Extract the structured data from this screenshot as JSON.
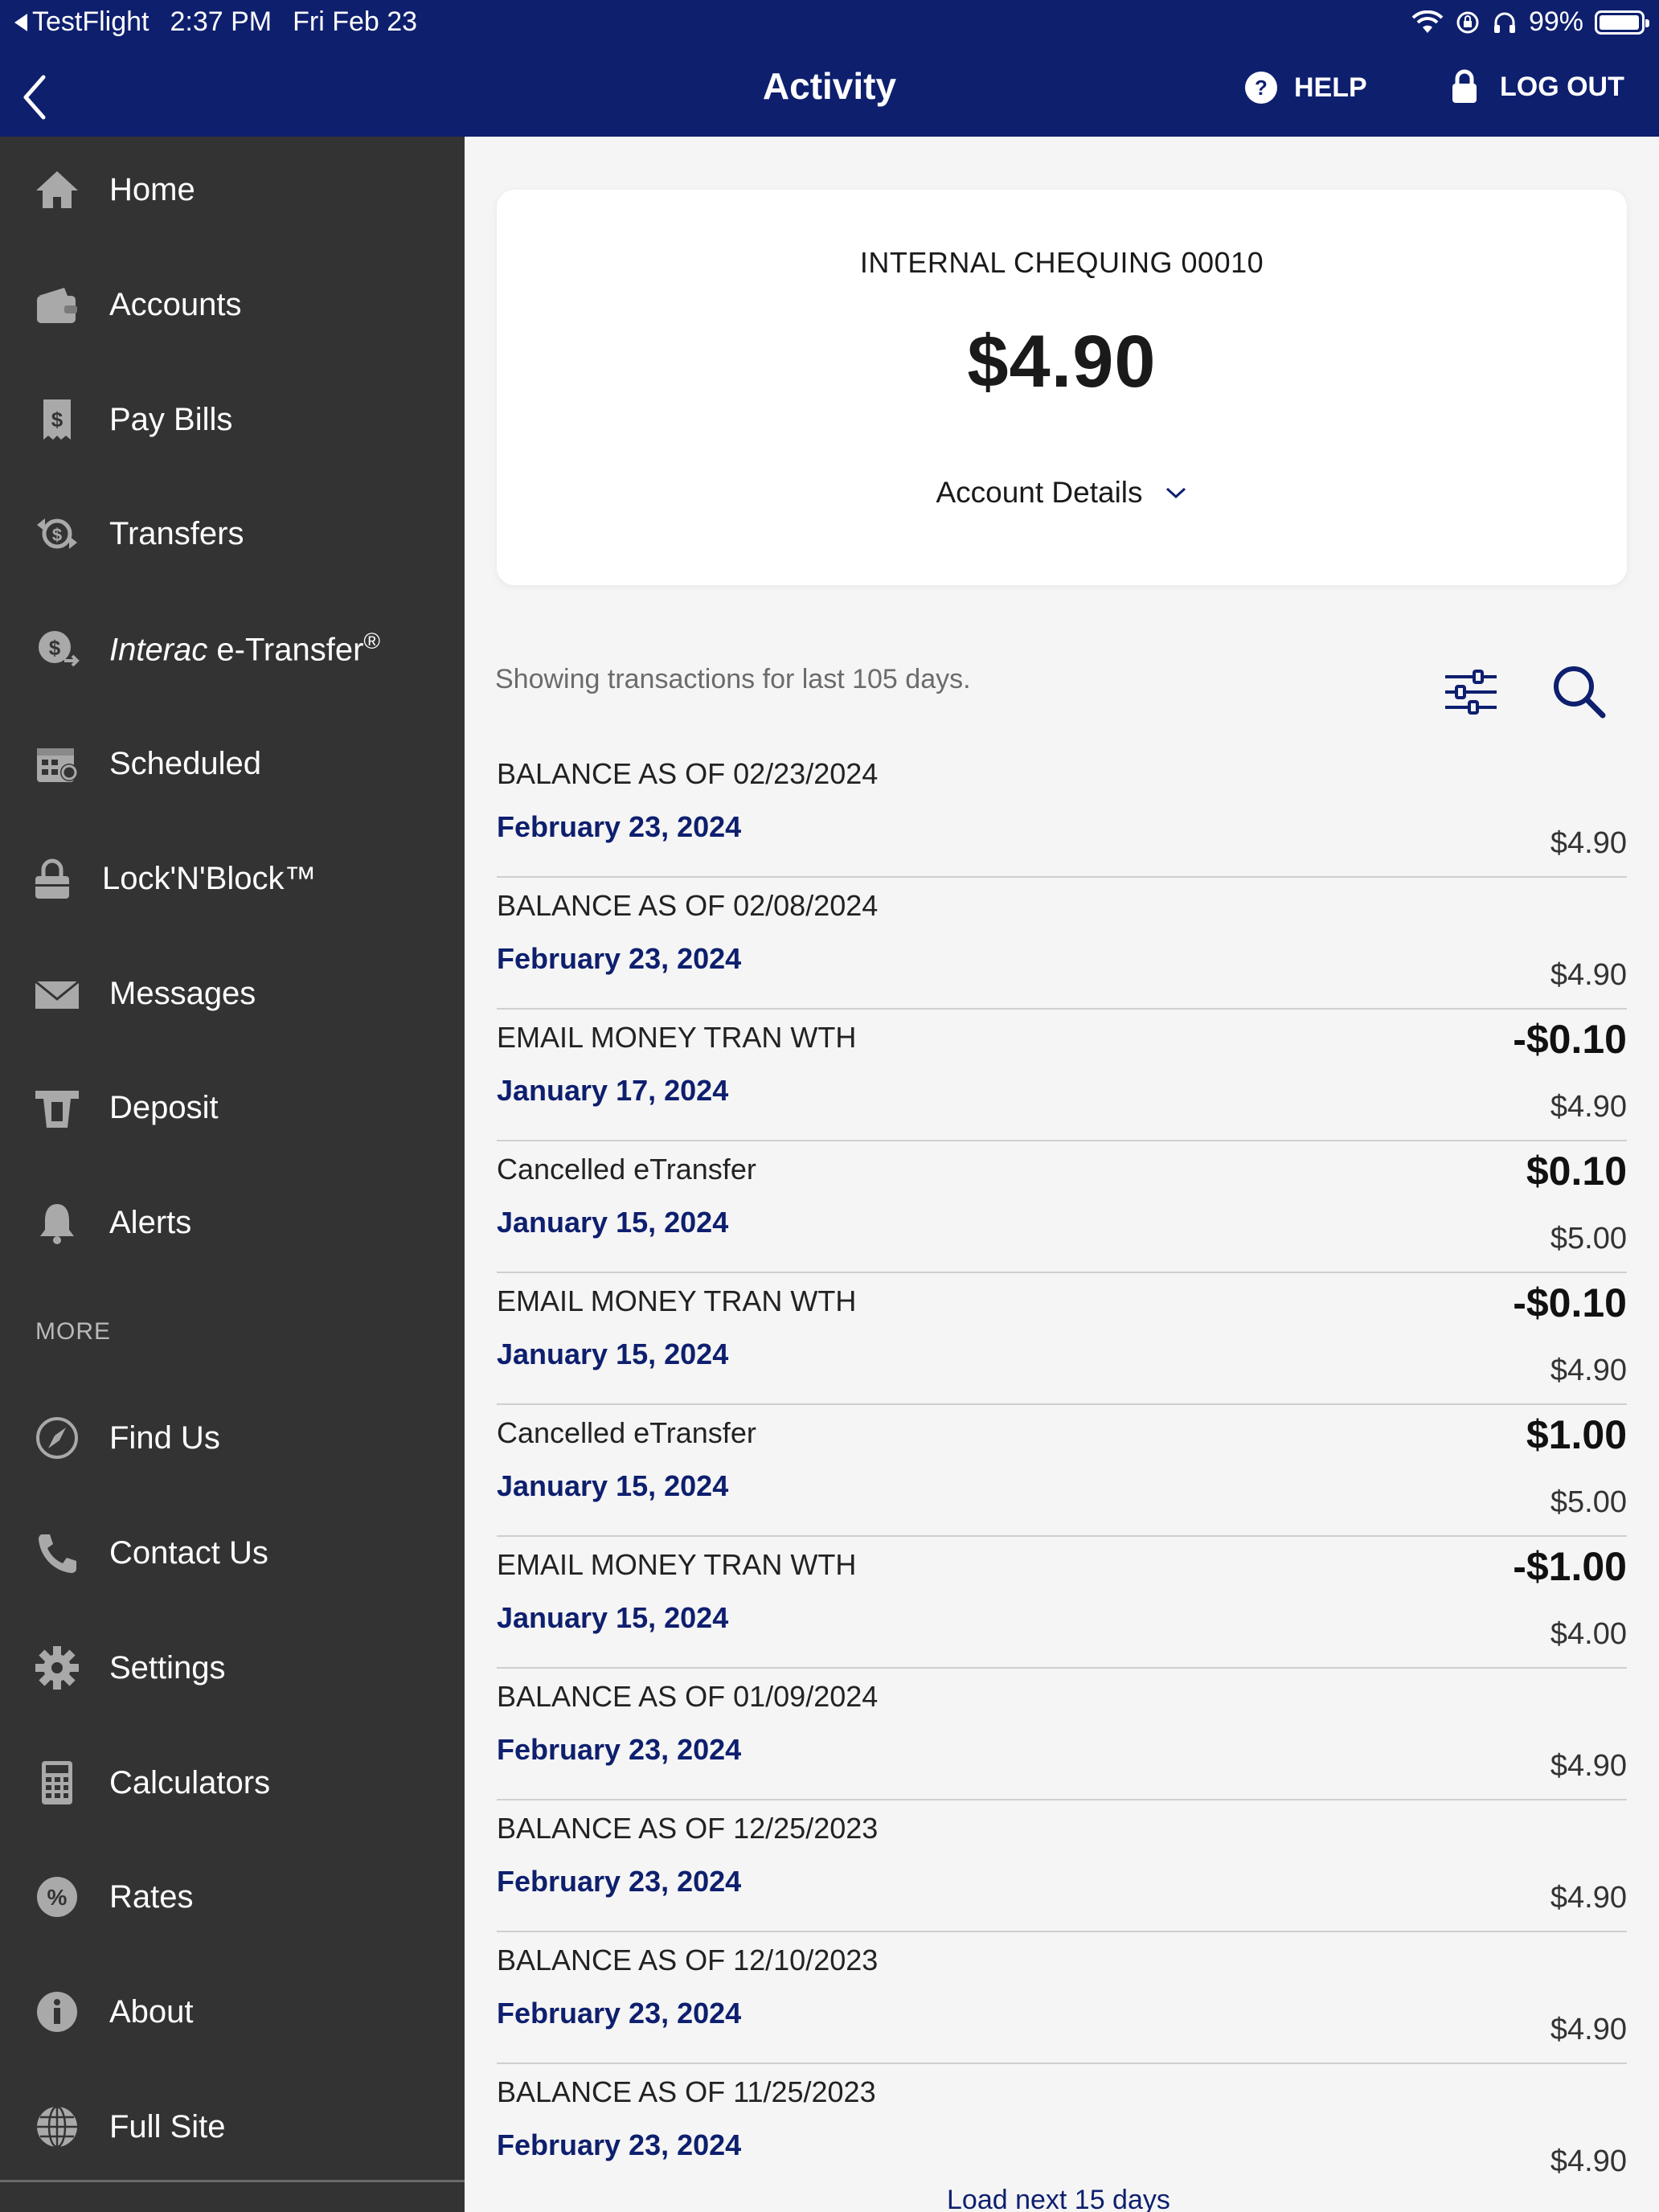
{
  "status_bar": {
    "back_app": "TestFlight",
    "time": "2:37 PM",
    "date": "Fri Feb 23",
    "battery": "99%"
  },
  "header": {
    "title": "Activity",
    "help_label": "HELP",
    "logout_label": "LOG OUT"
  },
  "sidebar": {
    "items": [
      {
        "label": "Home",
        "icon": "home-icon"
      },
      {
        "label": "Accounts",
        "icon": "wallet-icon"
      },
      {
        "label": "Pay Bills",
        "icon": "bill-icon"
      },
      {
        "label": "Transfers",
        "icon": "transfer-icon"
      },
      {
        "label_em": "Interac",
        "label_rest": " e-Transfer",
        "label_sup": "®",
        "icon": "etransfer-icon"
      },
      {
        "label": "Scheduled",
        "icon": "calendar-icon"
      },
      {
        "label": "Lock'N'Block™",
        "icon": "lock-icon"
      },
      {
        "label": "Messages",
        "icon": "envelope-icon"
      },
      {
        "label": "Deposit",
        "icon": "deposit-icon"
      },
      {
        "label": "Alerts",
        "icon": "bell-icon"
      }
    ],
    "more_header": "MORE",
    "more_items": [
      {
        "label": "Find Us",
        "icon": "compass-icon"
      },
      {
        "label": "Contact Us",
        "icon": "phone-icon"
      },
      {
        "label": "Settings",
        "icon": "gear-icon"
      },
      {
        "label": "Calculators",
        "icon": "calculator-icon"
      },
      {
        "label": "Rates",
        "icon": "percent-icon"
      },
      {
        "label": "About",
        "icon": "info-icon"
      },
      {
        "label": "Full Site",
        "icon": "globe-icon"
      }
    ]
  },
  "account": {
    "name": "INTERNAL CHEQUING 00010",
    "balance": "$4.90",
    "details_label": "Account Details"
  },
  "transactions_note": "Showing transactions for last 105 days.",
  "transactions": [
    {
      "desc": "BALANCE AS OF 02/23/2024",
      "date": "February 23, 2024",
      "amount": "",
      "balance": "$4.90"
    },
    {
      "desc": "BALANCE AS OF 02/08/2024",
      "date": "February 23, 2024",
      "amount": "",
      "balance": "$4.90"
    },
    {
      "desc": "EMAIL MONEY TRAN WTH",
      "date": "January 17, 2024",
      "amount": "-$0.10",
      "balance": "$4.90"
    },
    {
      "desc": "Cancelled eTransfer",
      "date": "January 15, 2024",
      "amount": "$0.10",
      "balance": "$5.00"
    },
    {
      "desc": "EMAIL MONEY TRAN WTH",
      "date": "January 15, 2024",
      "amount": "-$0.10",
      "balance": "$4.90"
    },
    {
      "desc": "Cancelled eTransfer",
      "date": "January 15, 2024",
      "amount": "$1.00",
      "balance": "$5.00"
    },
    {
      "desc": "EMAIL MONEY TRAN WTH",
      "date": "January 15, 2024",
      "amount": "-$1.00",
      "balance": "$4.00"
    },
    {
      "desc": "BALANCE AS OF 01/09/2024",
      "date": "February 23, 2024",
      "amount": "",
      "balance": "$4.90"
    },
    {
      "desc": "BALANCE AS OF 12/25/2023",
      "date": "February 23, 2024",
      "amount": "",
      "balance": "$4.90"
    },
    {
      "desc": "BALANCE AS OF 12/10/2023",
      "date": "February 23, 2024",
      "amount": "",
      "balance": "$4.90"
    },
    {
      "desc": "BALANCE AS OF 11/25/2023",
      "date": "February 23, 2024",
      "amount": "",
      "balance": "$4.90"
    }
  ],
  "load_more_label": "Load next 15 days",
  "colors": {
    "brand_navy": "#0e1f6e",
    "sidebar_bg": "#333333",
    "page_bg": "#f5f5f5"
  }
}
